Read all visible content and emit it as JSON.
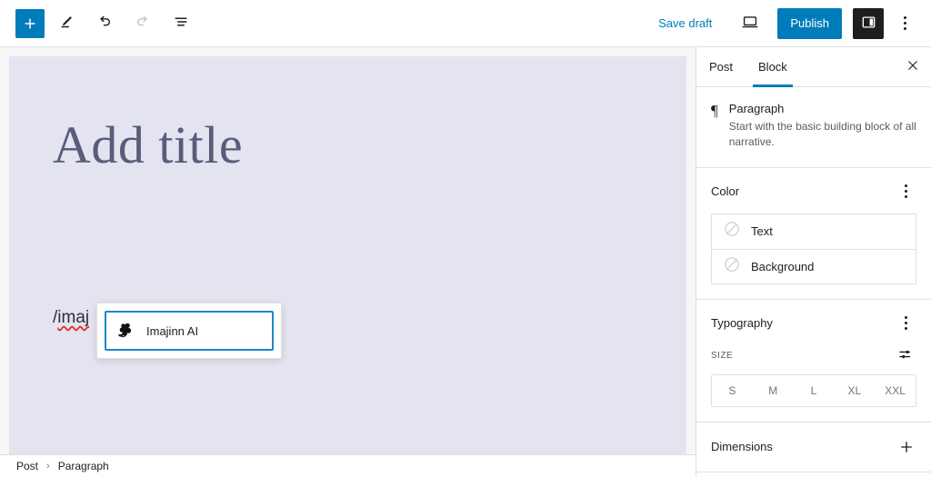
{
  "toolbar": {
    "add_block_label": "+",
    "add_block_icon": "plus-icon",
    "tools_icon": "pencil-icon",
    "undo_icon": "undo-arrow-icon",
    "redo_icon": "redo-arrow-icon",
    "list_view_icon": "list-view-icon",
    "save_draft_label": "Save draft",
    "preview_icon": "laptop-preview-icon",
    "publish_label": "Publish",
    "settings_toggle_icon": "sidebar-panel-icon",
    "more_menu_icon": "vertical-ellipsis-icon"
  },
  "editor": {
    "title_placeholder": "Add title",
    "paragraph_slash": "/",
    "paragraph_query": "imaj"
  },
  "slash_menu": {
    "items": [
      {
        "label": "Imajinn AI",
        "icon": "imajinn-genie-icon",
        "selected": true
      }
    ]
  },
  "sidebar": {
    "tabs": [
      {
        "label": "Post",
        "active": false
      },
      {
        "label": "Block",
        "active": true
      }
    ],
    "close_icon": "close-x-icon",
    "block_card": {
      "icon": "paragraph-pilcrow-icon",
      "icon_glyph": "¶",
      "title": "Paragraph",
      "description": "Start with the basic building block of all narrative."
    },
    "color_panel": {
      "title": "Color",
      "options_icon": "vertical-ellipsis-icon",
      "rows": [
        {
          "label": "Text",
          "swatch_icon": "no-color-circle-icon"
        },
        {
          "label": "Background",
          "swatch_icon": "no-color-circle-icon"
        }
      ]
    },
    "typography_panel": {
      "title": "Typography",
      "options_icon": "vertical-ellipsis-icon",
      "size_label": "SIZE",
      "size_settings_icon": "sliders-icon",
      "sizes": [
        "S",
        "M",
        "L",
        "XL",
        "XXL"
      ]
    },
    "dimensions_panel": {
      "title": "Dimensions",
      "add_icon": "plus-icon"
    }
  },
  "breadcrumb": {
    "items": [
      "Post",
      "Paragraph"
    ],
    "separator": "›"
  },
  "colors": {
    "accent_blue": "#007cba",
    "canvas_lavender": "#e3e4f0",
    "title_purple": "#5b5b7a",
    "dark_button": "#1e1e1e",
    "spell_error_red": "#e03030",
    "selection_border": "#1e86c7"
  }
}
